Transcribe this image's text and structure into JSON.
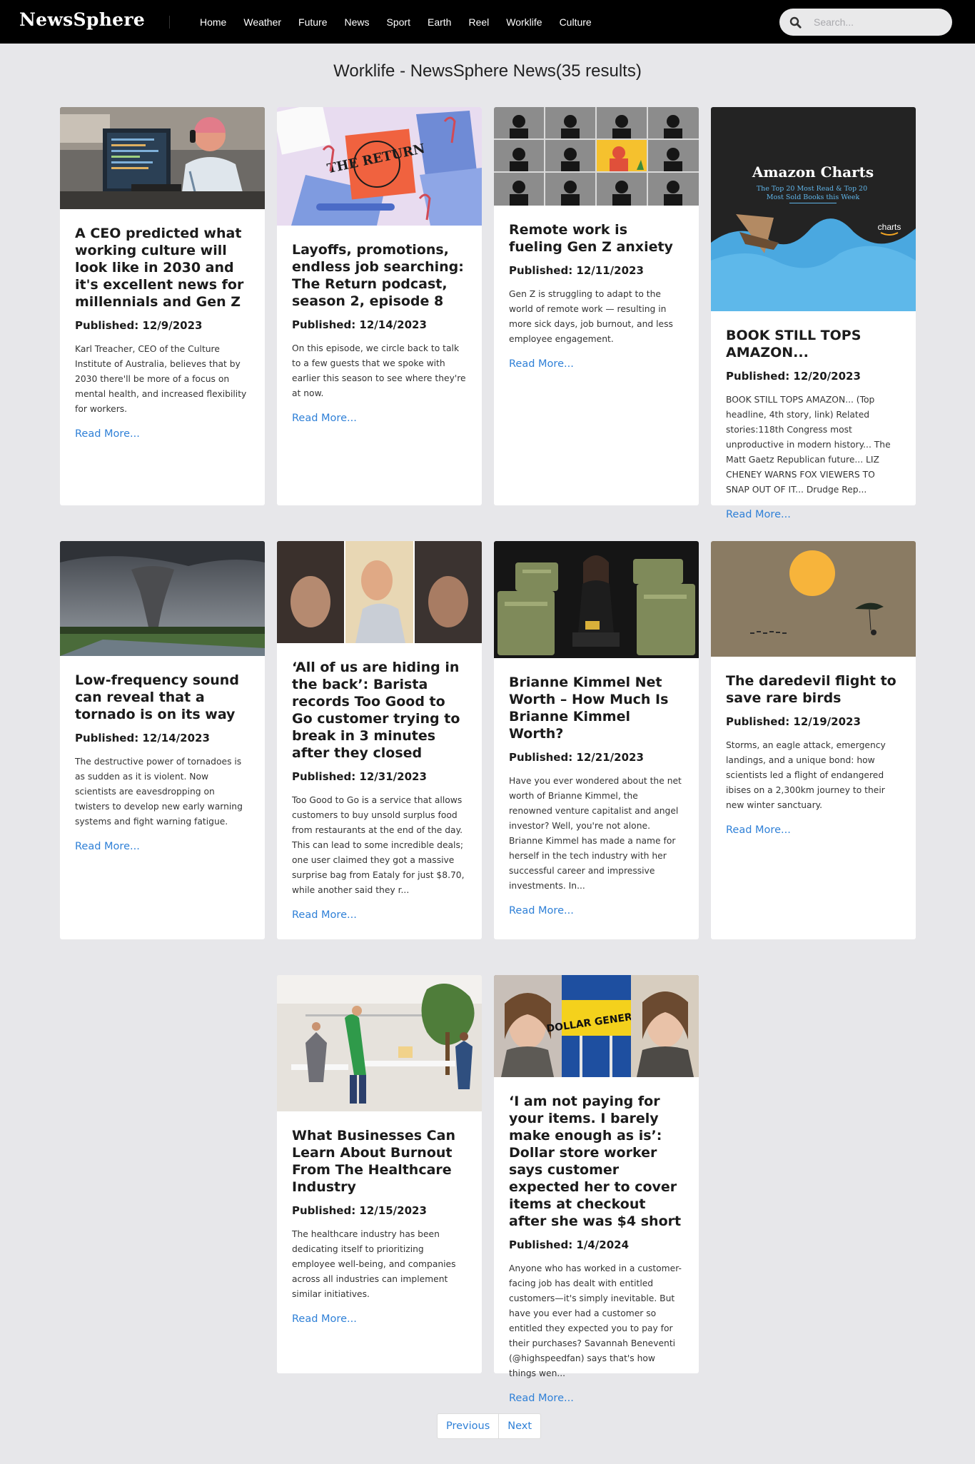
{
  "brand": "NewsSphere",
  "nav": [
    "Home",
    "Weather",
    "Future",
    "News",
    "Sport",
    "Earth",
    "Reel",
    "Worklife",
    "Culture"
  ],
  "search": {
    "placeholder": "Search..."
  },
  "page_title": "Worklife - NewsSphere News(35 results)",
  "read_more": "Read More...",
  "cards": [
    {
      "title": "A CEO predicted what working culture will look like in 2030 and it's excellent news for millennials and Gen Z",
      "published": "Published: 12/9/2023",
      "desc": "Karl Treacher, CEO of the Culture Institute of Australia, believes that by 2030 there'll be more of a focus on mental health, and increased flexibility for workers.",
      "image": "developer at desk with headphones"
    },
    {
      "title": "Layoffs, promotions, endless job searching: The Return podcast, season 2, episode 8",
      "published": "Published: 12/14/2023",
      "desc": "On this episode, we circle back to talk to a few guests that we spoke with earlier this season to see where they're at now.",
      "image": "The Return podcast artwork",
      "image_text": "THE RETURN"
    },
    {
      "title": "Remote work is fueling Gen Z anxiety",
      "published": "Published: 12/11/2023",
      "desc": "Gen Z is struggling to adapt to the world of remote work — resulting in more sick days, job burnout, and less employee engagement.",
      "image": "video call grid illustration"
    },
    {
      "title": "BOOK STILL TOPS AMAZON...",
      "published": "Published: 12/20/2023",
      "desc": "BOOK STILL TOPS AMAZON... (Top headline, 4th story, link) Related stories:118th Congress most unproductive in modern history... The Matt Gaetz Republican future... LIZ CHENEY WARNS FOX VIEWERS TO SNAP OUT OF IT... Drudge Rep...",
      "image": "Amazon Charts banner",
      "image_title": "Amazon Charts",
      "image_sub": "The Top 20 Most Read & Top 20\nMost Sold Books this Week",
      "image_logo": "charts"
    },
    {
      "title": "Low-frequency sound can reveal that a tornado is on its way",
      "published": "Published: 12/14/2023",
      "desc": "The destructive power of tornadoes is as sudden as it is violent. Now scientists are eavesdropping on twisters to develop new early warning systems and fight warning fatigue.",
      "image": "tornado over fields"
    },
    {
      "title": "‘All of us are hiding in the back’: Barista records Too Good to Go customer trying to break in 3 minutes after they closed",
      "published": "Published: 12/31/2023",
      "desc": "Too Good to Go is a service that allows customers to buy unsold surplus food from restaurants at the end of the day. This can lead to some incredible deals; one user claimed they got a massive surprise bag from Eataly for just $8.70, while another said they r...",
      "image": "barista video collage"
    },
    {
      "title": "Brianne Kimmel Net Worth – How Much Is Brianne Kimmel Worth?",
      "published": "Published: 12/21/2023",
      "desc": "Have you ever wondered about the net worth of Brianne Kimmel, the renowned venture capitalist and angel investor? Well, you're not alone. Brianne Kimmel has made a name for herself in the tech industry with her successful career and impressive investments. In...",
      "image": "woman seated on stacks of cash"
    },
    {
      "title": "The daredevil flight to save rare birds",
      "published": "Published: 12/19/2023",
      "desc": "Storms, an eagle attack, emergency landings, and a unique bond: how scientists led a flight of endangered ibises on a 2,300km journey to their new winter sanctuary.",
      "image": "paraglider and birds at sunset"
    },
    {
      "title": "What Businesses Can Learn About Burnout From The Healthcare Industry",
      "published": "Published: 12/15/2023",
      "desc": "The healthcare industry has been dedicating itself to prioritizing employee well-being, and companies across all industries can implement similar initiatives.",
      "image": "office workers stretching"
    },
    {
      "title": "‘I am not paying for your items. I barely make enough as is’: Dollar store worker says customer expected her to cover items at checkout after she was $4 short",
      "published": "Published: 1/4/2024",
      "desc": "Anyone who has worked in a customer-facing job has dealt with entitled customers—it's simply inevitable. But have you ever had a customer so entitled they expected you to pay for their purchases? Savannah Beneventi (@highspeedfan) says that's how things wen...",
      "image": "Dollar General worker video",
      "image_text": "DOLLAR GENERAL"
    }
  ],
  "pagination": {
    "previous": "Previous",
    "next": "Next"
  },
  "colors": {
    "accent": "#2f80d7",
    "topbar": "#000000",
    "page_bg": "#e7e7ea"
  }
}
